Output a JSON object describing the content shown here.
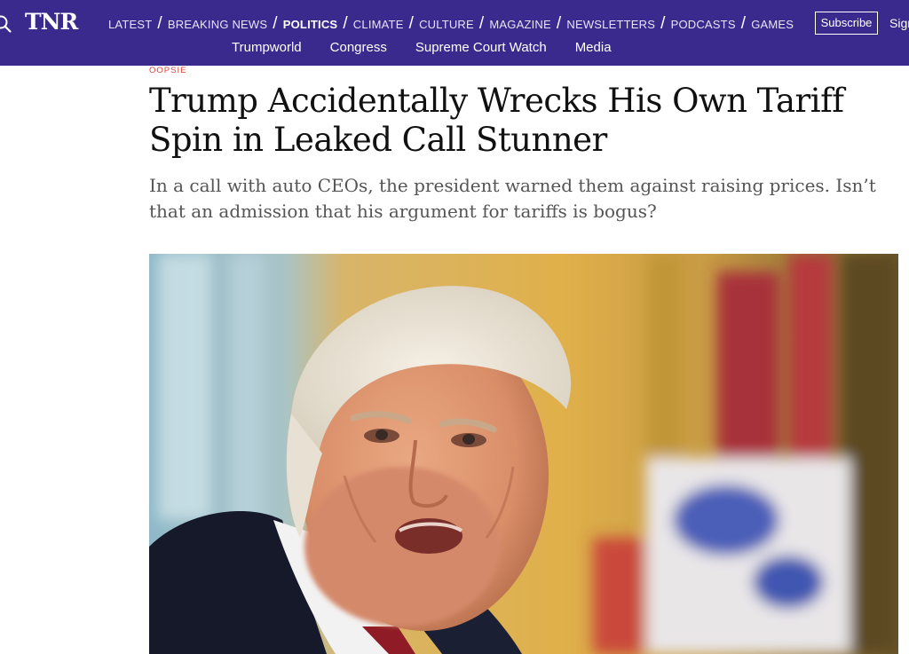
{
  "site": {
    "logo": "TNR"
  },
  "nav": {
    "primary": [
      "LATEST",
      "BREAKING NEWS",
      "POLITICS",
      "CLIMATE",
      "CULTURE",
      "MAGAZINE",
      "NEWSLETTERS",
      "PODCASTS",
      "GAMES"
    ],
    "active": "POLITICS",
    "secondary": [
      "Trumpworld",
      "Congress",
      "Supreme Court Watch",
      "Media"
    ],
    "subscribe_label": "Subscribe",
    "signin_label": "Sign"
  },
  "article": {
    "kicker": "OOPSIE",
    "headline": "Trump Accidentally Wrecks His Own Tariff Spin in Leaked Call Stunner",
    "dek": "In a call with auto CEOs, the president warned them against raising prices. Isn’t that an admission that his argument for tariffs is bogus?"
  },
  "icons": {
    "search": "search-icon"
  },
  "colors": {
    "header_bg": "#3b2a8e",
    "kicker": "#d94638",
    "headline": "#111111",
    "dek": "#555555"
  }
}
